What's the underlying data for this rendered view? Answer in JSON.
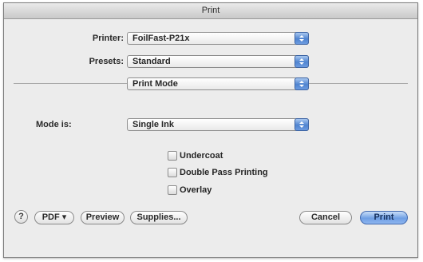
{
  "window": {
    "title": "Print"
  },
  "printer": {
    "label": "Printer:",
    "value": "FoilFast-P21x"
  },
  "presets": {
    "label": "Presets:",
    "value": "Standard"
  },
  "panel_selector": {
    "value": "Print Mode"
  },
  "mode": {
    "label": "Mode is:",
    "value": "Single Ink"
  },
  "options": [
    {
      "label": "Undercoat",
      "checked": false
    },
    {
      "label": "Double Pass Printing",
      "checked": false
    },
    {
      "label": "Overlay",
      "checked": false
    }
  ],
  "buttons": {
    "help": "?",
    "pdf": "PDF ▾",
    "preview": "Preview",
    "supplies": "Supplies...",
    "cancel": "Cancel",
    "print": "Print"
  },
  "colors": {
    "accent": "#4f84d0",
    "background": "#ececec"
  }
}
